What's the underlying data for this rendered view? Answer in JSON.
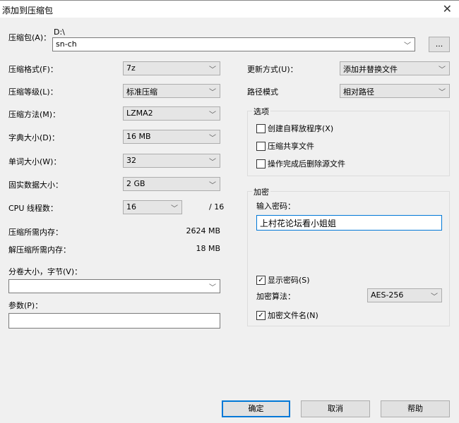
{
  "window": {
    "title": "添加到压缩包",
    "close_icon": "close-icon"
  },
  "archive": {
    "label": "压缩包(A)：",
    "path": "D:\\",
    "value": "sn-ch",
    "browse": "..."
  },
  "left": {
    "format": {
      "label": "压缩格式(F)：",
      "value": "7z"
    },
    "level": {
      "label": "压缩等级(L)：",
      "value": "标准压缩"
    },
    "method": {
      "label": "压缩方法(M)：",
      "value": "LZMA2"
    },
    "dict": {
      "label": "字典大小(D)：",
      "value": "16 MB"
    },
    "word": {
      "label": "单词大小(W)：",
      "value": "32"
    },
    "solid": {
      "label": "固实数据大小：",
      "value": "2 GB"
    },
    "cpu": {
      "label": "CPU 线程数：",
      "value": "16",
      "max": "/ 16"
    },
    "mem_comp": {
      "label": "压缩所需内存：",
      "value": "2624 MB"
    },
    "mem_decomp": {
      "label": "解压缩所需内存：",
      "value": "18 MB"
    },
    "volume": {
      "label": "分卷大小，字节(V)：",
      "value": ""
    },
    "params": {
      "label": "参数(P)：",
      "value": ""
    }
  },
  "right": {
    "update": {
      "label": "更新方式(U)：",
      "value": "添加并替换文件"
    },
    "pathmode": {
      "label": "路径模式",
      "value": "相对路径"
    },
    "options": {
      "title": "选项",
      "items": [
        {
          "label": "创建自释放程序(X)",
          "checked": false
        },
        {
          "label": "压缩共享文件",
          "checked": false
        },
        {
          "label": "操作完成后删除源文件",
          "checked": false
        }
      ]
    },
    "encryption": {
      "title": "加密",
      "password_label": "输入密码：",
      "password": "上村花论坛看小姐姐",
      "show_password": {
        "label": "显示密码(S)",
        "checked": true
      },
      "method_label": "加密算法：",
      "method": "AES-256",
      "encrypt_names": {
        "label": "加密文件名(N)",
        "checked": true
      }
    }
  },
  "buttons": {
    "ok": "确定",
    "cancel": "取消",
    "help": "帮助"
  },
  "colors": {
    "accent": "#0078d7"
  }
}
